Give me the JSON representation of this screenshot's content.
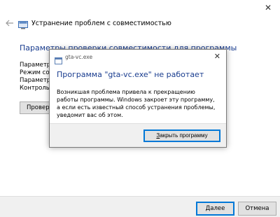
{
  "wizard": {
    "title": "Устранение проблем с совместимостью",
    "close_glyph": "✕",
    "heading": "Параметры проверки совместимости для программы",
    "lines": [
      "Параметры",
      "Режим совместимости",
      "Параметры",
      "Контроль учетных записей"
    ],
    "partial_button_label": "Проверить программу",
    "next_label": "Далее",
    "cancel_label": "Отмена"
  },
  "dialog": {
    "app_name": "gta-vc.exe",
    "close_glyph": "✕",
    "main_text": "Программа \"gta-vc.exe\" не работает",
    "body_text": "Возникшая проблема привела к прекращению работы программы. Windows закроет эту программу, а если есть известный способ устранения проблемы, уведомит вас об этом.",
    "button_hotkey": "З",
    "button_rest": "акрыть программу"
  },
  "colors": {
    "heading": "#1a3d8f",
    "focus_border": "#0078d7"
  },
  "icons": {
    "back": "back-arrow-icon",
    "wizard_app": "troubleshooter-icon",
    "dialog_app": "application-icon",
    "close": "close-icon"
  }
}
